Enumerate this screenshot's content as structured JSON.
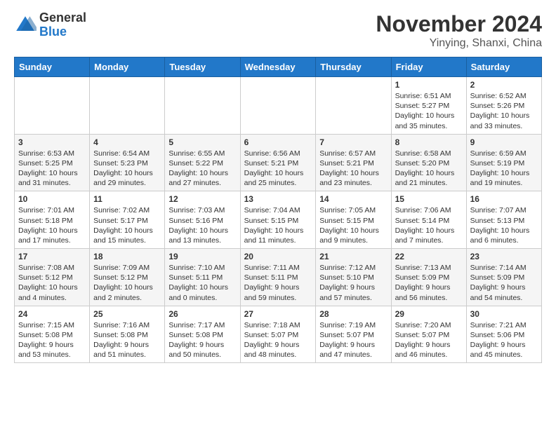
{
  "logo": {
    "general": "General",
    "blue": "Blue"
  },
  "title": "November 2024",
  "location": "Yinying, Shanxi, China",
  "days_header": [
    "Sunday",
    "Monday",
    "Tuesday",
    "Wednesday",
    "Thursday",
    "Friday",
    "Saturday"
  ],
  "weeks": [
    [
      {
        "day": "",
        "info": ""
      },
      {
        "day": "",
        "info": ""
      },
      {
        "day": "",
        "info": ""
      },
      {
        "day": "",
        "info": ""
      },
      {
        "day": "",
        "info": ""
      },
      {
        "day": "1",
        "info": "Sunrise: 6:51 AM\nSunset: 5:27 PM\nDaylight: 10 hours and 35 minutes."
      },
      {
        "day": "2",
        "info": "Sunrise: 6:52 AM\nSunset: 5:26 PM\nDaylight: 10 hours and 33 minutes."
      }
    ],
    [
      {
        "day": "3",
        "info": "Sunrise: 6:53 AM\nSunset: 5:25 PM\nDaylight: 10 hours and 31 minutes."
      },
      {
        "day": "4",
        "info": "Sunrise: 6:54 AM\nSunset: 5:23 PM\nDaylight: 10 hours and 29 minutes."
      },
      {
        "day": "5",
        "info": "Sunrise: 6:55 AM\nSunset: 5:22 PM\nDaylight: 10 hours and 27 minutes."
      },
      {
        "day": "6",
        "info": "Sunrise: 6:56 AM\nSunset: 5:21 PM\nDaylight: 10 hours and 25 minutes."
      },
      {
        "day": "7",
        "info": "Sunrise: 6:57 AM\nSunset: 5:21 PM\nDaylight: 10 hours and 23 minutes."
      },
      {
        "day": "8",
        "info": "Sunrise: 6:58 AM\nSunset: 5:20 PM\nDaylight: 10 hours and 21 minutes."
      },
      {
        "day": "9",
        "info": "Sunrise: 6:59 AM\nSunset: 5:19 PM\nDaylight: 10 hours and 19 minutes."
      }
    ],
    [
      {
        "day": "10",
        "info": "Sunrise: 7:01 AM\nSunset: 5:18 PM\nDaylight: 10 hours and 17 minutes."
      },
      {
        "day": "11",
        "info": "Sunrise: 7:02 AM\nSunset: 5:17 PM\nDaylight: 10 hours and 15 minutes."
      },
      {
        "day": "12",
        "info": "Sunrise: 7:03 AM\nSunset: 5:16 PM\nDaylight: 10 hours and 13 minutes."
      },
      {
        "day": "13",
        "info": "Sunrise: 7:04 AM\nSunset: 5:15 PM\nDaylight: 10 hours and 11 minutes."
      },
      {
        "day": "14",
        "info": "Sunrise: 7:05 AM\nSunset: 5:15 PM\nDaylight: 10 hours and 9 minutes."
      },
      {
        "day": "15",
        "info": "Sunrise: 7:06 AM\nSunset: 5:14 PM\nDaylight: 10 hours and 7 minutes."
      },
      {
        "day": "16",
        "info": "Sunrise: 7:07 AM\nSunset: 5:13 PM\nDaylight: 10 hours and 6 minutes."
      }
    ],
    [
      {
        "day": "17",
        "info": "Sunrise: 7:08 AM\nSunset: 5:12 PM\nDaylight: 10 hours and 4 minutes."
      },
      {
        "day": "18",
        "info": "Sunrise: 7:09 AM\nSunset: 5:12 PM\nDaylight: 10 hours and 2 minutes."
      },
      {
        "day": "19",
        "info": "Sunrise: 7:10 AM\nSunset: 5:11 PM\nDaylight: 10 hours and 0 minutes."
      },
      {
        "day": "20",
        "info": "Sunrise: 7:11 AM\nSunset: 5:11 PM\nDaylight: 9 hours and 59 minutes."
      },
      {
        "day": "21",
        "info": "Sunrise: 7:12 AM\nSunset: 5:10 PM\nDaylight: 9 hours and 57 minutes."
      },
      {
        "day": "22",
        "info": "Sunrise: 7:13 AM\nSunset: 5:09 PM\nDaylight: 9 hours and 56 minutes."
      },
      {
        "day": "23",
        "info": "Sunrise: 7:14 AM\nSunset: 5:09 PM\nDaylight: 9 hours and 54 minutes."
      }
    ],
    [
      {
        "day": "24",
        "info": "Sunrise: 7:15 AM\nSunset: 5:08 PM\nDaylight: 9 hours and 53 minutes."
      },
      {
        "day": "25",
        "info": "Sunrise: 7:16 AM\nSunset: 5:08 PM\nDaylight: 9 hours and 51 minutes."
      },
      {
        "day": "26",
        "info": "Sunrise: 7:17 AM\nSunset: 5:08 PM\nDaylight: 9 hours and 50 minutes."
      },
      {
        "day": "27",
        "info": "Sunrise: 7:18 AM\nSunset: 5:07 PM\nDaylight: 9 hours and 48 minutes."
      },
      {
        "day": "28",
        "info": "Sunrise: 7:19 AM\nSunset: 5:07 PM\nDaylight: 9 hours and 47 minutes."
      },
      {
        "day": "29",
        "info": "Sunrise: 7:20 AM\nSunset: 5:07 PM\nDaylight: 9 hours and 46 minutes."
      },
      {
        "day": "30",
        "info": "Sunrise: 7:21 AM\nSunset: 5:06 PM\nDaylight: 9 hours and 45 minutes."
      }
    ]
  ]
}
